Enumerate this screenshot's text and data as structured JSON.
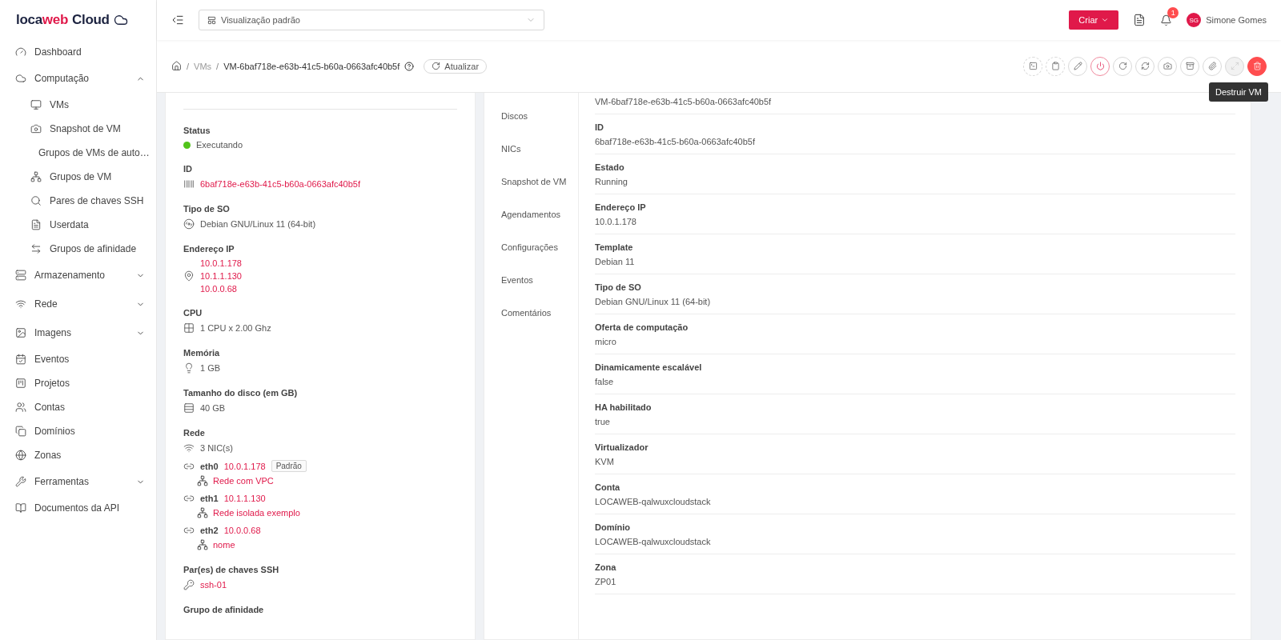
{
  "brand": {
    "name_dark": "loca",
    "name_accent": "web",
    "product": "Cloud"
  },
  "sidebar": {
    "items": [
      {
        "label": "Dashboard",
        "kind": "link"
      },
      {
        "label": "Computação",
        "kind": "group",
        "expanded": true,
        "children": [
          {
            "label": "VMs"
          },
          {
            "label": "Snapshot de VM"
          },
          {
            "label": "Grupos de VMs de auto…"
          },
          {
            "label": "Grupos de VM"
          },
          {
            "label": "Pares de chaves SSH"
          },
          {
            "label": "Userdata"
          },
          {
            "label": "Grupos de afinidade"
          }
        ]
      },
      {
        "label": "Armazenamento",
        "kind": "group",
        "expanded": false
      },
      {
        "label": "Rede",
        "kind": "group",
        "expanded": false
      },
      {
        "label": "Imagens",
        "kind": "group",
        "expanded": false
      },
      {
        "label": "Eventos",
        "kind": "link"
      },
      {
        "label": "Projetos",
        "kind": "link"
      },
      {
        "label": "Contas",
        "kind": "link"
      },
      {
        "label": "Domínios",
        "kind": "link"
      },
      {
        "label": "Zonas",
        "kind": "link"
      },
      {
        "label": "Ferramentas",
        "kind": "group",
        "expanded": false
      },
      {
        "label": "Documentos da API",
        "kind": "link"
      }
    ]
  },
  "topbar": {
    "view_select": {
      "value": "Visualização padrão"
    },
    "create_button": "Criar",
    "notification_count": "1",
    "user": {
      "initials": "SG",
      "name": "Simone Gomes"
    }
  },
  "breadcrumb": {
    "separator": "/",
    "items": [
      "VMs",
      "VM-6baf718e-e63b-41c5-b60a-0663afc40b5f"
    ],
    "refresh_button": "Atualizar"
  },
  "actions": [
    {
      "kind": "dashed"
    },
    {
      "kind": "dashed"
    },
    {
      "kind": "normal"
    },
    {
      "kind": "danger-outline"
    },
    {
      "kind": "normal"
    },
    {
      "kind": "normal"
    },
    {
      "kind": "normal"
    },
    {
      "kind": "normal"
    },
    {
      "kind": "normal"
    },
    {
      "kind": "disabled"
    },
    {
      "kind": "danger"
    }
  ],
  "tooltip": "Destruir VM",
  "details": [
    {
      "label": "Status",
      "kind": "status",
      "value": "Executando",
      "color": "#52c41a"
    },
    {
      "label": "ID",
      "kind": "id",
      "value": "6baf718e-e63b-41c5-b60a-0663afc40b5f"
    },
    {
      "label": "Tipo de SO",
      "kind": "text",
      "value": "Debian GNU/Linux 11 (64-bit)"
    },
    {
      "label": "Endereço IP",
      "kind": "ips",
      "values": [
        "10.0.1.178",
        "10.1.1.130",
        "10.0.0.68"
      ]
    },
    {
      "label": "CPU",
      "kind": "text",
      "value": "1 CPU x 2.00 Ghz"
    },
    {
      "label": "Memória",
      "kind": "text",
      "value": "1 GB"
    },
    {
      "label": "Tamanho do disco (em GB)",
      "kind": "text",
      "value": "40 GB"
    },
    {
      "label": "Rede",
      "kind": "network",
      "value": "3 NIC(s)",
      "nics": [
        {
          "name": "eth0",
          "ip": "10.0.1.178",
          "badge": "Padrão",
          "network": "Rede com VPC"
        },
        {
          "name": "eth1",
          "ip": "10.1.1.130",
          "network": "Rede isolada exemplo"
        },
        {
          "name": "eth2",
          "ip": "10.0.0.68",
          "network": "nome"
        }
      ]
    },
    {
      "label": "Par(es) de chaves SSH",
      "kind": "ssh",
      "value": "ssh-01"
    },
    {
      "label": "Grupo de afinidade",
      "kind": "heading"
    }
  ],
  "tabs": [
    {
      "label": "Discos",
      "selected": false
    },
    {
      "label": "NICs",
      "selected": false
    },
    {
      "label": "Snapshot de VM",
      "selected": false
    },
    {
      "label": "Agendamentos",
      "selected": false
    },
    {
      "label": "Configurações",
      "selected": false
    },
    {
      "label": "Eventos",
      "selected": false
    },
    {
      "label": "Comentários",
      "selected": false
    }
  ],
  "fields": [
    {
      "value": "VM-6baf718e-e63b-41c5-b60a-0663afc40b5f"
    },
    {
      "label": "ID",
      "value": "6baf718e-e63b-41c5-b60a-0663afc40b5f"
    },
    {
      "label": "Estado",
      "value": "Running"
    },
    {
      "label": "Endereço IP",
      "value": "10.0.1.178"
    },
    {
      "label": "Template",
      "value": "Debian 11"
    },
    {
      "label": "Tipo de SO",
      "value": "Debian GNU/Linux 11 (64-bit)"
    },
    {
      "label": "Oferta de computação",
      "value": "micro"
    },
    {
      "label": "Dinamicamente escalável",
      "value": "false"
    },
    {
      "label": "HA habilitado",
      "value": "true"
    },
    {
      "label": "Virtualizador",
      "value": "KVM"
    },
    {
      "label": "Conta",
      "value": "LOCAWEB-qalwuxcloudstack"
    },
    {
      "label": "Domínio",
      "value": "LOCAWEB-qalwuxcloudstack"
    },
    {
      "label": "Zona",
      "value": "ZP01"
    }
  ]
}
